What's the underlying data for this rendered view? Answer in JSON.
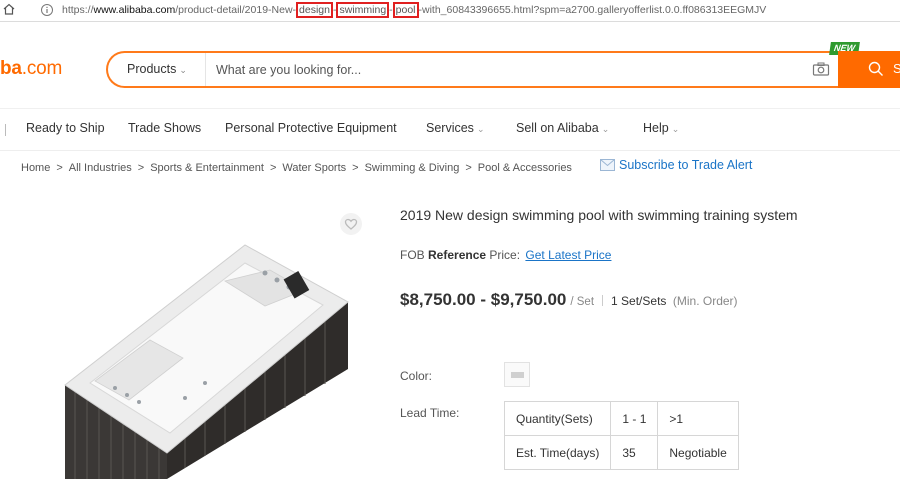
{
  "browser": {
    "url_prefix": "https://",
    "url_host": "www.alibaba.com",
    "url_path_1": "/product-detail/2019-New-",
    "url_hl_1": "design",
    "url_mid_1": "-",
    "url_hl_2": "swimming",
    "url_mid_2": "-",
    "url_hl_3": "pool",
    "url_path_2": "-with_60843396655.html?spm=a2700.galleryofferlist.0.0.ff086313EEGMJV"
  },
  "header": {
    "logo_main": "ba",
    "logo_tld": ".com",
    "category": "Products",
    "search_placeholder": "What are you looking for...",
    "search_button_letter": "S",
    "new_badge": "NEW",
    "brand_color": "#ff6a00"
  },
  "nav": {
    "items": [
      {
        "label": "Ready to Ship"
      },
      {
        "label": "Trade Shows"
      },
      {
        "label": "Personal Protective Equipment"
      },
      {
        "label": "Services"
      },
      {
        "label": "Sell on Alibaba"
      },
      {
        "label": "Help"
      }
    ]
  },
  "breadcrumb": {
    "items": [
      "Home",
      "All Industries",
      "Sports & Entertainment",
      "Water Sports",
      "Swimming & Diving",
      "Pool & Accessories"
    ],
    "separator": ">",
    "subscribe": "Subscribe to Trade Alert"
  },
  "product": {
    "title": "2019 New design swimming pool with swimming training system",
    "fob_label_1": "FOB",
    "fob_label_2": "Reference",
    "fob_label_3": "Price:",
    "fob_link": "Get Latest Price",
    "price_range": "$8,750.00 - $9,750.00",
    "price_unit": "/ Set",
    "moq": "1 Set/Sets",
    "moq_note": "(Min. Order)",
    "color_label": "Color:",
    "lead_time_label": "Lead Time:",
    "lead_table": {
      "rows": [
        [
          "Quantity(Sets)",
          "1 - 1",
          ">1"
        ],
        [
          "Est. Time(days)",
          "35",
          "Negotiable"
        ]
      ]
    }
  }
}
